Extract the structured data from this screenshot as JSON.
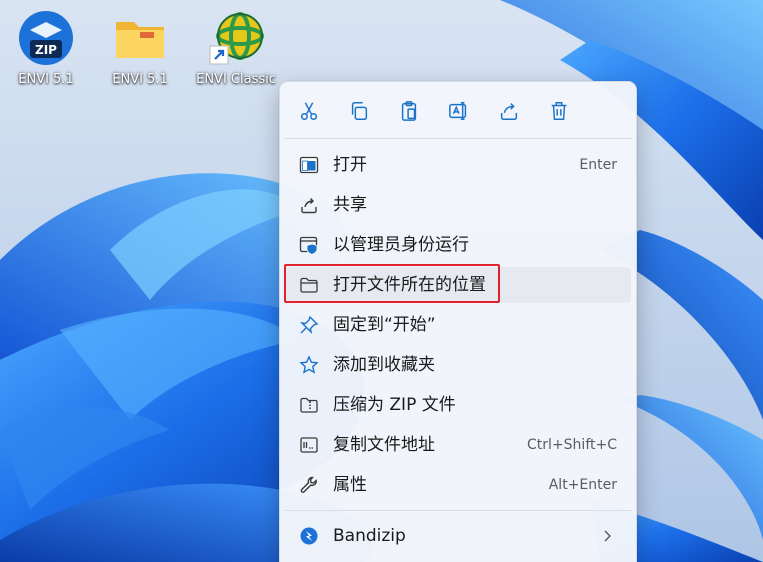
{
  "desktop": {
    "icons": [
      {
        "name": "ENVI 5.1",
        "kind": "zip-icon"
      },
      {
        "name": "ENVI 5.1",
        "kind": "folder-icon"
      },
      {
        "name": "ENVI Classic",
        "kind": "globe-shortcut-icon"
      }
    ],
    "zip_badge": "ZIP"
  },
  "toolbar": {
    "buttons": [
      {
        "icon": "cut-icon"
      },
      {
        "icon": "copy-icon"
      },
      {
        "icon": "paste-icon"
      },
      {
        "icon": "rename-icon"
      },
      {
        "icon": "share-icon"
      },
      {
        "icon": "delete-icon"
      }
    ]
  },
  "menu": {
    "items": [
      {
        "label": "打开",
        "shortcut": "Enter",
        "icon": "open-window-icon"
      },
      {
        "label": "共享",
        "shortcut": "",
        "icon": "share-icon"
      },
      {
        "label": "以管理员身份运行",
        "shortcut": "",
        "icon": "shield-admin-icon"
      },
      {
        "label": "打开文件所在的位置",
        "shortcut": "",
        "icon": "folder-icon",
        "highlighted": true
      },
      {
        "label": "固定到“开始”",
        "shortcut": "",
        "icon": "pin-icon"
      },
      {
        "label": "添加到收藏夹",
        "shortcut": "",
        "icon": "star-icon"
      },
      {
        "label": "压缩为 ZIP 文件",
        "shortcut": "",
        "icon": "zip-folder-icon"
      },
      {
        "label": "复制文件地址",
        "shortcut": "Ctrl+Shift+C",
        "icon": "copy-path-icon"
      },
      {
        "label": "属性",
        "shortcut": "Alt+Enter",
        "icon": "wrench-icon"
      }
    ],
    "submenu": {
      "label": "Bandizip",
      "icon": "bandizip-icon",
      "chevron": "chevron-right-icon"
    }
  },
  "colors": {
    "accent": "#1a73c8",
    "highlight_border": "#e0232a",
    "menu_bg": "#f3f6fb",
    "wallpaper_blue": "#1f6fe0"
  }
}
